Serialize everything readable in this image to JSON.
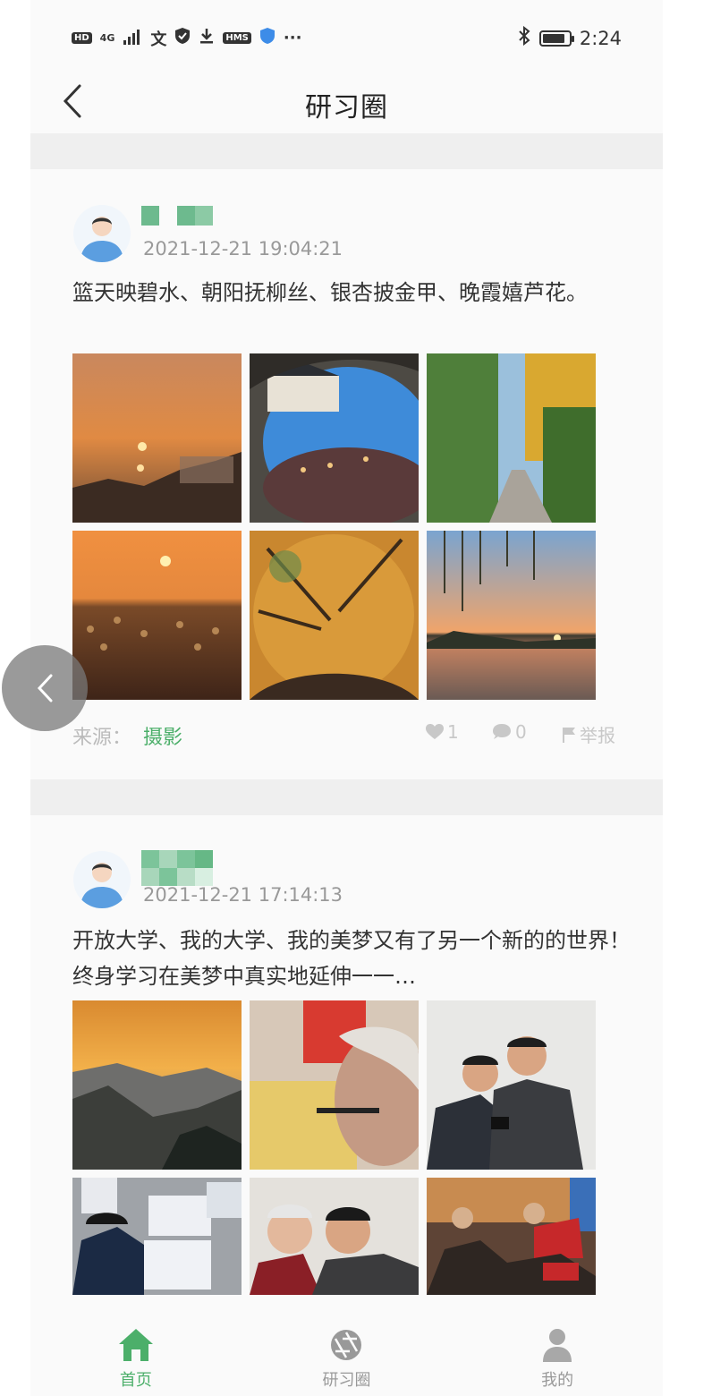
{
  "status_bar": {
    "left_items": [
      "HD",
      "4G",
      "signal",
      "translate",
      "shield",
      "download",
      "HMS",
      "blue-shield",
      "more"
    ],
    "hd": "HD",
    "network": "4G",
    "hms": "HMS",
    "more": "···",
    "time": "2:24",
    "battery_level": 0.85
  },
  "header": {
    "title": "研习圈"
  },
  "posts": [
    {
      "timestamp": "2021-12-21 19:04:21",
      "text": "篮天映碧水、朝阳抚柳丝、银杏披金甲、晚霞嬉芦花。",
      "source_label": "来源：",
      "source_value": "摄影",
      "likes": "1",
      "comments": "0",
      "report": "举报"
    },
    {
      "timestamp": "2021-12-21 17:14:13",
      "text": "开放大学、我的大学、我的美梦又有了另一个新的的世界！终身学习在美梦中真实地延伸一一…"
    }
  ],
  "nav": [
    {
      "label": "首页",
      "icon": "home-icon",
      "active": true
    },
    {
      "label": "研习圈",
      "icon": "aperture-icon",
      "active": false
    },
    {
      "label": "我的",
      "icon": "user-icon",
      "active": false
    }
  ],
  "colors": {
    "accent": "#4caf6a",
    "inactive": "#999999"
  }
}
